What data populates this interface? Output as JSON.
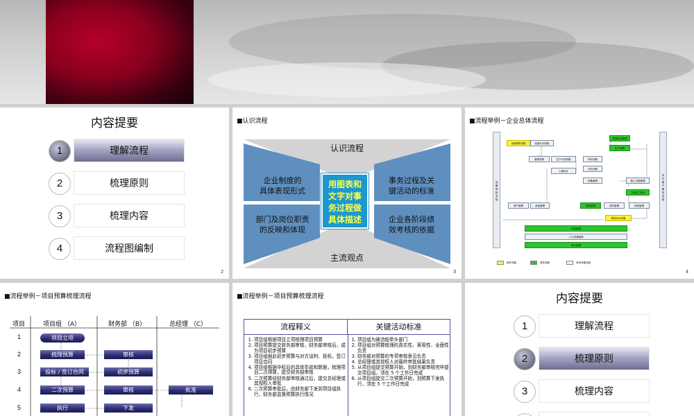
{
  "toc": {
    "title": "内容提要",
    "items": [
      {
        "num": "1",
        "label": "理解流程"
      },
      {
        "num": "2",
        "label": "梳理原则"
      },
      {
        "num": "3",
        "label": "梳理内容"
      },
      {
        "num": "4",
        "label": "流程图编制"
      }
    ]
  },
  "slide1": {
    "active_index": 1,
    "page": "2"
  },
  "slide2": {
    "title": "认识流程",
    "top": "认识流程",
    "bottom": "主流观点",
    "left_top": "企业制度的\n具体表现形式",
    "left_bottom": "部门及岗位职责\n的反映和体现",
    "right_top": "事务过程及关\n键活动的标准",
    "right_bottom": "企业各阶段绩\n效考核的依据",
    "center": "用图表和\n文字对事\n务过程做\n具体描述",
    "page": "3"
  },
  "slide3": {
    "title": "流程举例－企业总体流程",
    "page": "4",
    "legend": [
      "缺失流程",
      "现有流程",
      "有待完善流程"
    ]
  },
  "slide4": {
    "title": "流程举例－项目预算梳理流程",
    "headers": [
      "项目",
      "项目组 （A）",
      "财务部 （B）",
      "总经理 （C）"
    ],
    "rows": [
      "1",
      "2",
      "3",
      "4",
      "5"
    ],
    "nodes": {
      "a1": "项目立项",
      "a2": "梳理预算",
      "a3": "投标 / 签订合同",
      "a4": "二次预算",
      "a5": "执行",
      "b2": "审核",
      "b3": "初步预算",
      "b4": "审核",
      "b5": "下发",
      "c4": "批准"
    }
  },
  "slide5": {
    "title": "流程举例－项目预算梳理流程",
    "col1_header": "流程释义",
    "col2_header": "关键活动标准",
    "col1": [
      "项目组根据项目立项梳理项目预算",
      "项目预算提交财务部审核，财务部审核后，成为项目初步预算",
      "项目组据此初步预算与对方谈判、投标，签订项目合同",
      "项目组根据中标后的具体条款和数据，梳理项目二次预算，提交财务部审核",
      "二次预算经财务部审核通过后，提交总经理或其授权人审批",
      "二次预算审批后，由财务部下发到项目组执行，财务部监督预算执行情况"
    ],
    "col2": [
      "项目组为被流程牵头部门",
      "项目组对预算梳理的真实性、客观性、全面性负责",
      "财务部对预算的专项审核意见负责",
      "总经理或其授权人对最终审批结果负责",
      "从项目组提交预算开始，到财务部审核完毕提交项目组，须在 5 个工作日完成",
      "从项目组提交二次预算开始，到预算下发执行，须在 5 个工作日完成"
    ]
  },
  "slide6": {
    "active_index": 2
  }
}
